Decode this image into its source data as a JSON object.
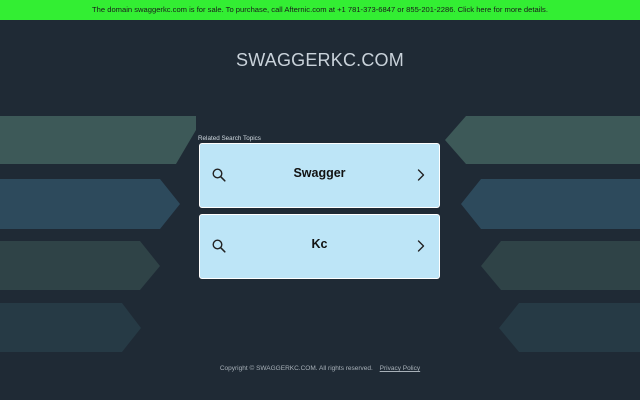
{
  "banner": {
    "text": "The domain swaggerkc.com is for sale. To purchase, call Afternic.com at +1 781-373-6847 or 855-201-2286. Click here for more details."
  },
  "site": {
    "title": "SWAGGERKC.COM"
  },
  "related": {
    "label": "Related Search Topics",
    "topics": [
      {
        "label": "Swagger",
        "icon": "search-icon",
        "arrow": "chevron-right-icon"
      },
      {
        "label": "Kc",
        "icon": "search-icon",
        "arrow": "chevron-right-icon"
      }
    ]
  },
  "footer": {
    "copyright": "Copyright © SWAGGERKC.COM.  All rights reserved.",
    "privacy_label": "Privacy Policy"
  },
  "colors": {
    "banner_bg": "#33ee33",
    "page_bg": "#1f2a35",
    "card_bg": "#bde5f7",
    "card_border": "#ffffff"
  }
}
